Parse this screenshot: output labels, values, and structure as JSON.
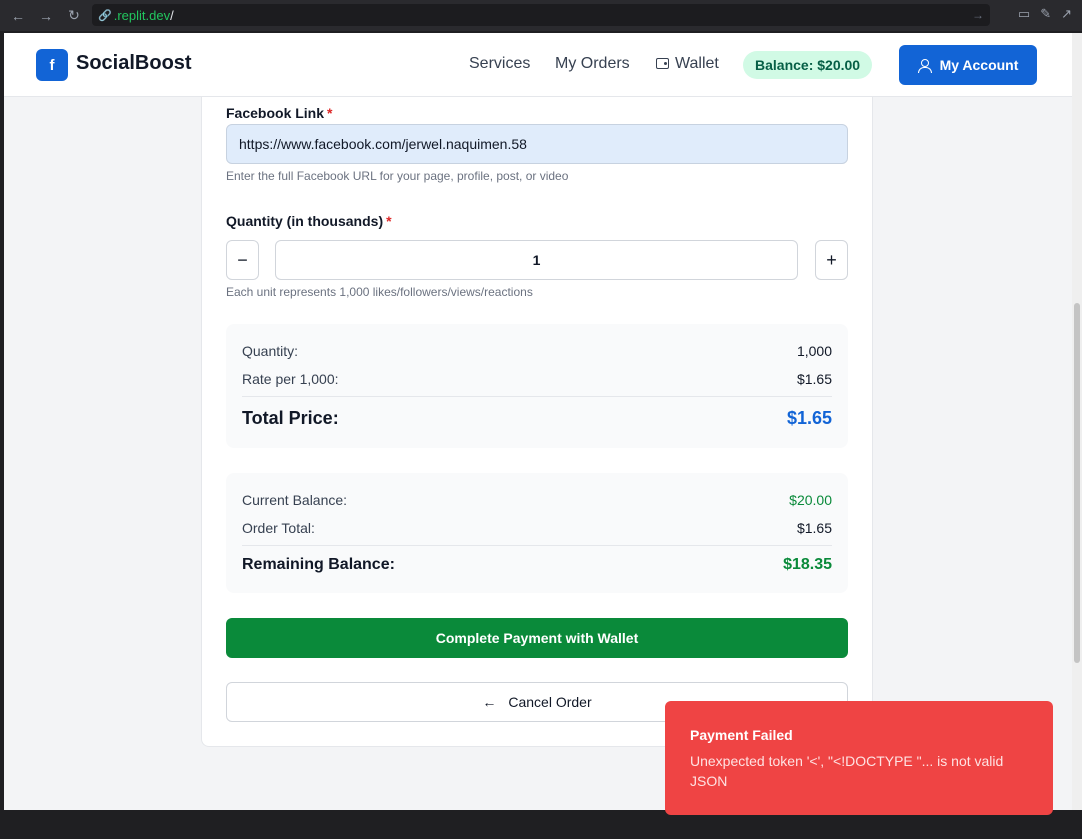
{
  "browser": {
    "url_host": ".replit.dev",
    "url_path": "/"
  },
  "header": {
    "brand": "SocialBoost",
    "logo_glyph": "f",
    "nav": {
      "services": "Services",
      "orders": "My Orders",
      "wallet": "Wallet"
    },
    "balance": "Balance: $20.00",
    "account": "My Account"
  },
  "form": {
    "link_label": "Facebook Link",
    "required_mark": "*",
    "link_value": "https://www.facebook.com/jerwel.naquimen.58",
    "link_hint": "Enter the full Facebook URL for your page, profile, post, or video",
    "qty_label": "Quantity (in thousands)",
    "qty_value": "1",
    "qty_minus": "−",
    "qty_plus": "+",
    "qty_hint": "Each unit represents 1,000 likes/followers/views/reactions"
  },
  "price_summary": {
    "quantity_label": "Quantity:",
    "quantity_value": "1,000",
    "rate_label": "Rate per 1,000:",
    "rate_value": "$1.65",
    "total_label": "Total Price:",
    "total_value": "$1.65"
  },
  "balance_summary": {
    "current_label": "Current Balance:",
    "current_value": "$20.00",
    "order_label": "Order Total:",
    "order_value": "$1.65",
    "remaining_label": "Remaining Balance:",
    "remaining_value": "$18.35"
  },
  "actions": {
    "pay": "Complete Payment with Wallet",
    "cancel": "Cancel Order",
    "cancel_arrow": "←"
  },
  "toast": {
    "title": "Payment Failed",
    "message": "Unexpected token '<', \"<!DOCTYPE \"... is not valid JSON"
  },
  "colors": {
    "primary": "#1264d6",
    "success": "#0a8a3a",
    "error": "#ef4444",
    "balance_bg": "#d1fae5"
  }
}
